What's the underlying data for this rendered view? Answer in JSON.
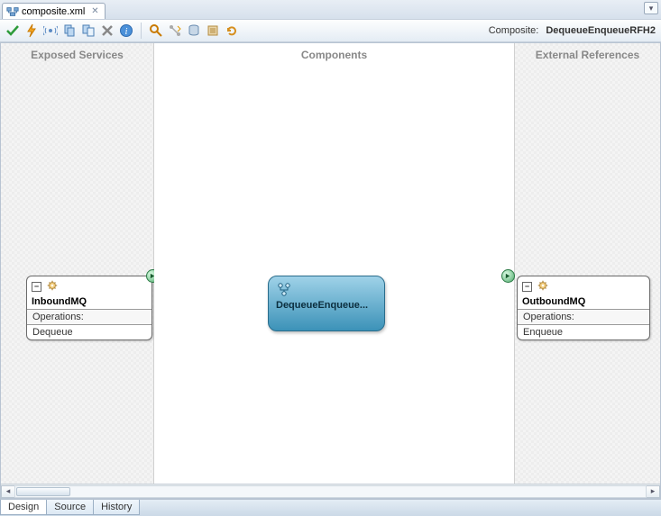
{
  "tab": {
    "label": "composite.xml"
  },
  "toolbar": {
    "composite_label": "Composite:",
    "composite_name": "DequeueEnqueueRFH2"
  },
  "lanes": {
    "left_header": "Exposed Services",
    "mid_header": "Components",
    "right_header": "External References"
  },
  "inbound": {
    "title": "InboundMQ",
    "ops_header": "Operations:",
    "op": "Dequeue",
    "collapse": "⊟"
  },
  "outbound": {
    "title": "OutboundMQ",
    "ops_header": "Operations:",
    "op": "Enqueue",
    "collapse": "⊟"
  },
  "component": {
    "label": "DequeueEnqueue..."
  },
  "bottom_tabs": {
    "design": "Design",
    "source": "Source",
    "history": "History"
  }
}
